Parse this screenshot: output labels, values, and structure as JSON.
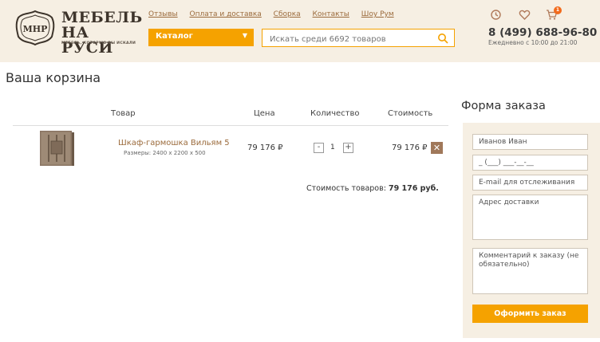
{
  "header": {
    "logo": {
      "emblem_text": "МНР",
      "title_line1": "МЕБЕЛЬ",
      "title_line2": "НА РУСИ",
      "tagline": "МЕБЕЛЬ, КОТОРУЮ ВЫ ИСКАЛИ"
    },
    "nav": [
      "Отзывы",
      "Оплата и доставка",
      "Сборка",
      "Контакты",
      "Шоу Рум"
    ],
    "catalog_label": "Каталог",
    "search_placeholder": "Искать среди 6692 товаров",
    "icons": [
      "history-icon",
      "heart-icon",
      "cart-icon"
    ],
    "cart_count": "1",
    "phone": "8 (499) 688-96-80",
    "hours": "Ежедневно с 10:00 до 21:00",
    "colors": {
      "bg": "#f6efe3",
      "accent": "#f5a200",
      "link": "#9b6b3c",
      "badge": "#f26a1b"
    }
  },
  "cart": {
    "title": "Ваша корзина",
    "columns": [
      "Товар",
      "Цена",
      "Количество",
      "Стоимость"
    ],
    "item": {
      "name": "Шкаф-гармошка Вильям 5",
      "sizes": "Размеры: 2400 x 2200 x 500",
      "price": "79 176 ₽",
      "qty": "1",
      "qty_minus": "-",
      "qty_plus": "+",
      "cost": "79 176 ₽",
      "remove": "✕"
    },
    "total_label": "Стоимость товаров:",
    "total_value": "79 176 руб."
  },
  "order_form": {
    "title": "Форма заказа",
    "name_value": "Иванов Иван",
    "phone_value": "_ (___) ___-__-__",
    "email_placeholder": "E-mail для отслеживания",
    "address_placeholder": "Адрес доставки",
    "comment_placeholder": "Комментарий к заказу (не обязательно)",
    "submit_label": "Оформить заказ"
  }
}
